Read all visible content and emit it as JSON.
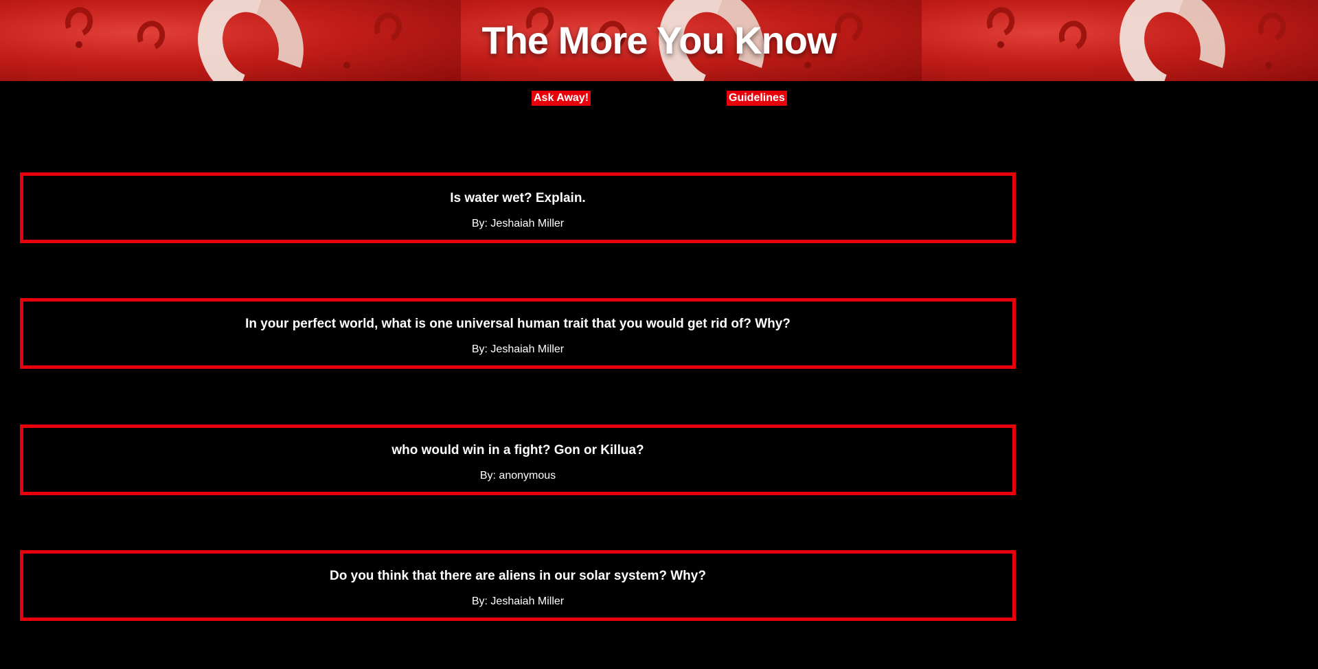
{
  "header": {
    "title": "The More You Know"
  },
  "nav": {
    "ask_label": "Ask Away!",
    "guidelines_label": "Guidelines"
  },
  "posts": [
    {
      "question": "Is water wet? Explain.",
      "author": "By: Jeshaiah Miller"
    },
    {
      "question": "In your perfect world, what is one universal human trait that you would get rid of? Why?",
      "author": "By: Jeshaiah Miller"
    },
    {
      "question": "who would win in a fight? Gon or Killua?",
      "author": "By: anonymous"
    },
    {
      "question": "Do you think that there are aliens in our solar system? Why?",
      "author": "By: Jeshaiah Miller"
    }
  ],
  "colors": {
    "background": "#000000",
    "accent": "#e8000b",
    "banner": "#c8201c",
    "text": "#ffffff"
  }
}
